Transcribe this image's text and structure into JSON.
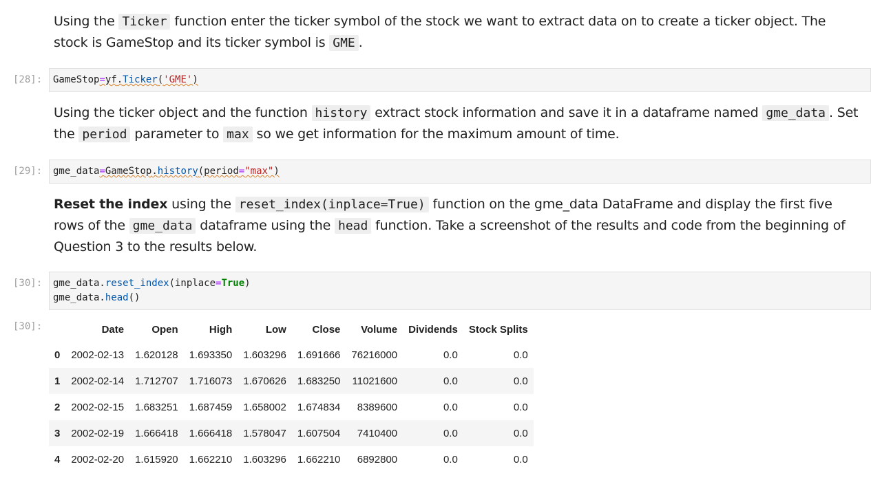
{
  "md1": {
    "t1": "Using the ",
    "c1": "Ticker",
    "t2": " function enter the ticker symbol of the stock we want to extract data on to create a ticker object. The stock is GameStop and its ticker symbol is ",
    "c2": "GME",
    "t3": "."
  },
  "cell28": {
    "prompt": "[28]:",
    "line1": {
      "a": "GameStop",
      "b": "=",
      "c": "yf",
      "d": ".",
      "e": "Ticker",
      "f": "(",
      "g": "'GME'",
      "h": ")"
    }
  },
  "md2": {
    "t1": "Using the ticker object and the function ",
    "c1": "history",
    "t2": " extract stock information and save it in a dataframe named ",
    "c2": "gme_data",
    "t3": ". Set the ",
    "c3": "period",
    "t4": " parameter to ",
    "c4": "max",
    "t5": " so we get information for the maximum amount of time."
  },
  "cell29": {
    "prompt": "[29]:",
    "line1": {
      "a": "gme_data",
      "b": "=",
      "c": "GameStop",
      "d": ".",
      "e": "history",
      "f": "(",
      "g": "period",
      "h": "=",
      "i": "\"max\"",
      "j": ")"
    }
  },
  "md3": {
    "b1": "Reset the index",
    "t1": " using the ",
    "c1": "reset_index(inplace=True)",
    "t2": " function on the gme_data DataFrame and display the first five rows of the ",
    "c2": "gme_data",
    "t3": " dataframe using the ",
    "c3": "head",
    "t4": " function. Take a screenshot of the results and code from the beginning of Question 3 to the results below."
  },
  "cell30": {
    "prompt": "[30]:",
    "line1": {
      "a": "gme_data.",
      "b": "reset_index",
      "c": "(inplace",
      "d": "=",
      "e": "True",
      "f": ")"
    },
    "line2": {
      "a": "gme_data.",
      "b": "head",
      "c": "()"
    }
  },
  "out30": {
    "prompt": "[30]:",
    "columns": [
      "",
      "Date",
      "Open",
      "High",
      "Low",
      "Close",
      "Volume",
      "Dividends",
      "Stock Splits"
    ],
    "rows": [
      [
        "0",
        "2002-02-13",
        "1.620128",
        "1.693350",
        "1.603296",
        "1.691666",
        "76216000",
        "0.0",
        "0.0"
      ],
      [
        "1",
        "2002-02-14",
        "1.712707",
        "1.716073",
        "1.670626",
        "1.683250",
        "11021600",
        "0.0",
        "0.0"
      ],
      [
        "2",
        "2002-02-15",
        "1.683251",
        "1.687459",
        "1.658002",
        "1.674834",
        "8389600",
        "0.0",
        "0.0"
      ],
      [
        "3",
        "2002-02-19",
        "1.666418",
        "1.666418",
        "1.578047",
        "1.607504",
        "7410400",
        "0.0",
        "0.0"
      ],
      [
        "4",
        "2002-02-20",
        "1.615920",
        "1.662210",
        "1.603296",
        "1.662210",
        "6892800",
        "0.0",
        "0.0"
      ]
    ]
  }
}
